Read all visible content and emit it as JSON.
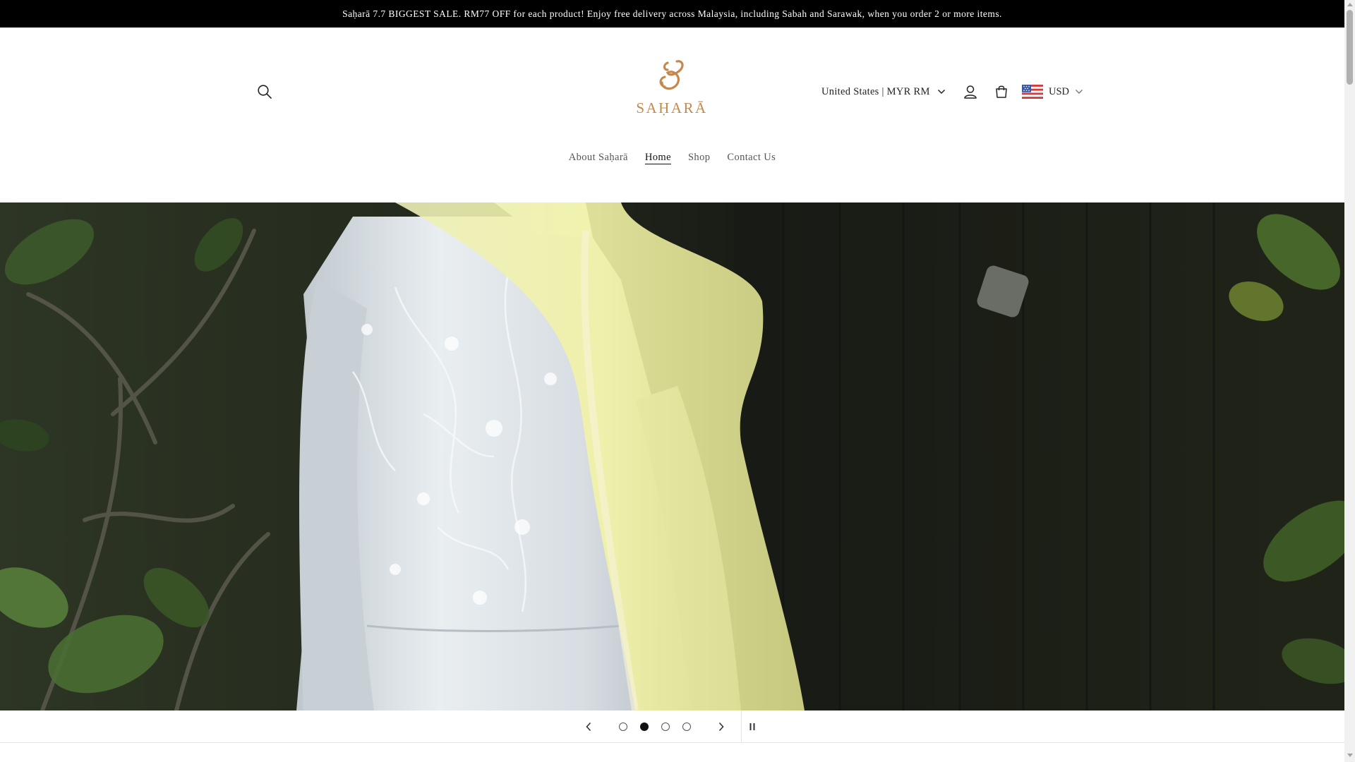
{
  "announcement": {
    "text": "Saḥarā 7.7 BIGGEST SALE. RM77 OFF for each product! Enjoy free delivery across Malaysia, including Sabah and Sarawak, when you order 2 or more items."
  },
  "header": {
    "logo_text": "SAḤARĀ",
    "country_selector": "United States | MYR RM",
    "currency_selector": "USD",
    "icons": {
      "search": "search-icon",
      "account": "account-icon",
      "cart": "cart-icon",
      "flag": "us-flag-icon"
    }
  },
  "nav": {
    "items": [
      {
        "label": "About Saḥarā",
        "active": false
      },
      {
        "label": "Home",
        "active": true
      },
      {
        "label": "Shop",
        "active": false
      },
      {
        "label": "Contact Us",
        "active": false
      }
    ]
  },
  "slideshow": {
    "slide_count": 4,
    "current_slide": 2,
    "controls": {
      "prev": "chevron-left-icon",
      "next": "chevron-right-icon",
      "pause": "pause-icon"
    }
  },
  "colors": {
    "announcement_bg": "#000000",
    "logo_gold": "#c4884f",
    "text": "#121212"
  }
}
